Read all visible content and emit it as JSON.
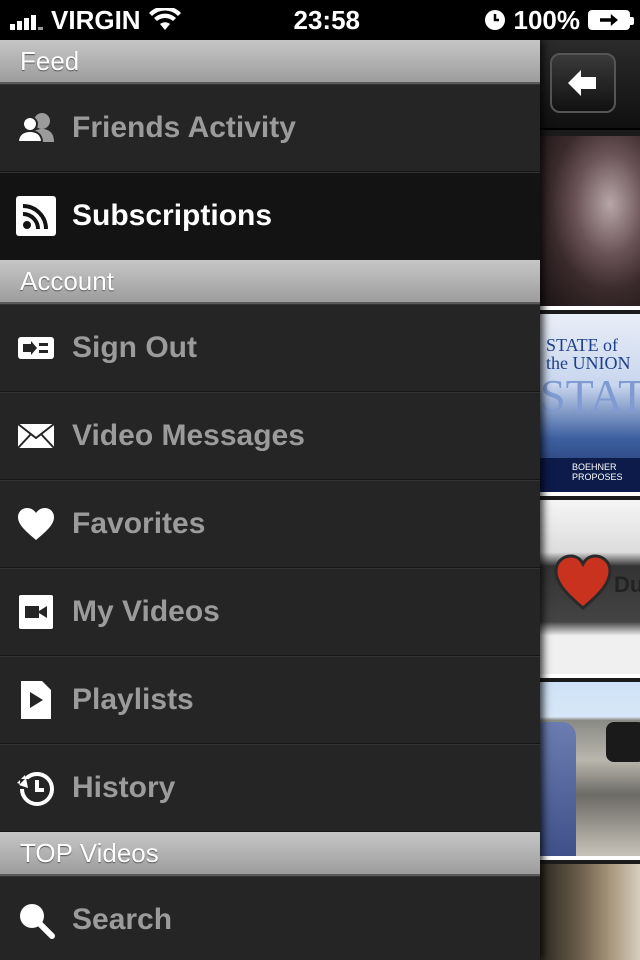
{
  "status_bar": {
    "carrier": "VIRGIN",
    "time": "23:58",
    "battery": "100%"
  },
  "menu": {
    "sections": [
      {
        "header": "Feed",
        "items": [
          {
            "label": "Friends Activity",
            "icon": "friends-icon",
            "active": false
          },
          {
            "label": "Subscriptions",
            "icon": "rss-icon",
            "active": true
          }
        ]
      },
      {
        "header": "Account",
        "items": [
          {
            "label": "Sign Out",
            "icon": "plug-icon",
            "active": false
          },
          {
            "label": "Video Messages",
            "icon": "envelope-icon",
            "active": false
          },
          {
            "label": "Favorites",
            "icon": "heart-icon",
            "active": false
          },
          {
            "label": "My Videos",
            "icon": "video-camera-icon",
            "active": false
          },
          {
            "label": "Playlists",
            "icon": "playlist-icon",
            "active": false
          },
          {
            "label": "History",
            "icon": "history-icon",
            "active": false
          }
        ]
      },
      {
        "header": "TOP Videos",
        "items": [
          {
            "label": "Search",
            "icon": "search-icon",
            "active": false
          }
        ]
      }
    ]
  },
  "content": {
    "back_button_icon": "back-arrow-icon",
    "thumbnails": [
      {
        "caption": ""
      },
      {
        "caption": "STATE of the UNION",
        "ticker": "BOEHNER PROPOSES"
      },
      {
        "caption": "Du"
      },
      {
        "caption": ""
      },
      {
        "caption": ""
      }
    ]
  },
  "colors": {
    "menu_bg": "#252525",
    "active_bg": "#131313",
    "section_header": "#b3b3b3",
    "label_inactive": "#9b9b9b",
    "label_active": "#ffffff"
  }
}
